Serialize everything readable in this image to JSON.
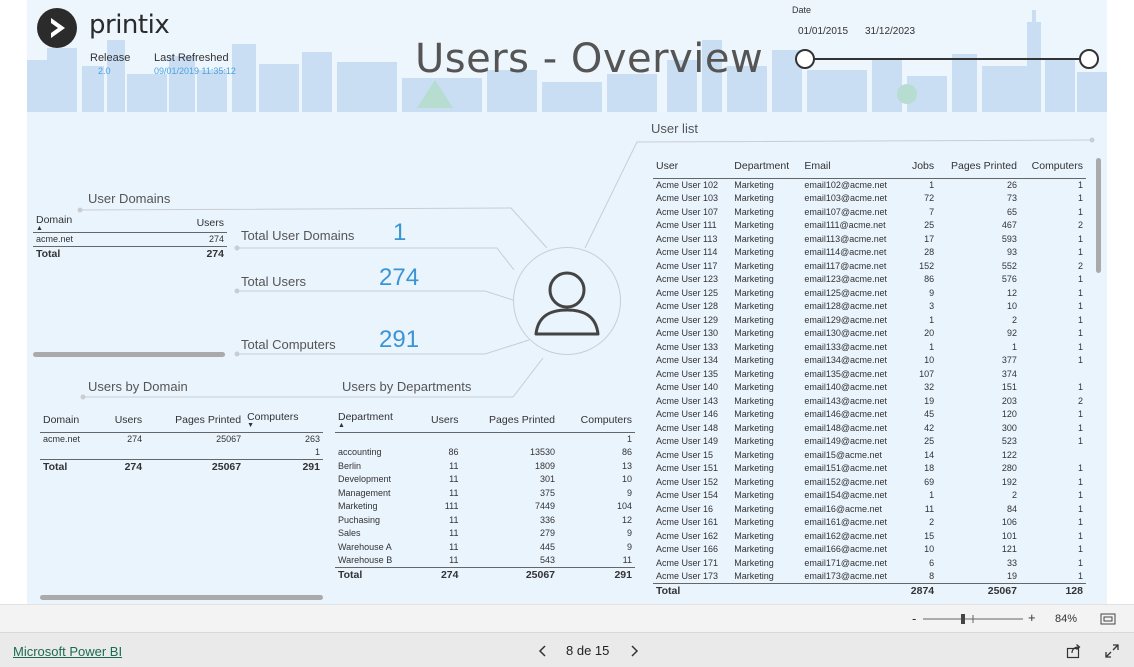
{
  "header": {
    "logo_text": "printix",
    "release_label": "Release",
    "release_value": "2.0",
    "refreshed_label": "Last Refreshed",
    "refreshed_value": "09/01/2019 11:35:12",
    "title": "Users - Overview",
    "date_label": "Date",
    "date_start": "01/01/2015",
    "date_end": "31/12/2023"
  },
  "user_domains": {
    "title": "User Domains",
    "headers": [
      "Domain",
      "Users"
    ],
    "rows": [
      [
        "acme.net",
        "274"
      ]
    ],
    "total": [
      "Total",
      "274"
    ]
  },
  "kpis": [
    {
      "label": "Total User Domains",
      "value": "1"
    },
    {
      "label": "Total Users",
      "value": "274"
    },
    {
      "label": "Total Computers",
      "value": "291"
    }
  ],
  "users_by_domain": {
    "title": "Users by Domain",
    "headers": [
      "Domain",
      "Users",
      "Pages Printed",
      "Computers"
    ],
    "rows": [
      [
        "acme.net",
        "274",
        "25067",
        "263"
      ],
      [
        "",
        "",
        "",
        "1"
      ]
    ],
    "total": [
      "Total",
      "274",
      "25067",
      "291"
    ]
  },
  "users_by_departments": {
    "title": "Users by Departments",
    "headers": [
      "Department",
      "Users",
      "Pages Printed",
      "Computers"
    ],
    "rows": [
      [
        "",
        "",
        "",
        "1"
      ],
      [
        "accounting",
        "86",
        "13530",
        "86"
      ],
      [
        "Berlin",
        "11",
        "1809",
        "13"
      ],
      [
        "Development",
        "11",
        "301",
        "10"
      ],
      [
        "Management",
        "11",
        "375",
        "9"
      ],
      [
        "Marketing",
        "111",
        "7449",
        "104"
      ],
      [
        "Puchasing",
        "11",
        "336",
        "12"
      ],
      [
        "Sales",
        "11",
        "279",
        "9"
      ],
      [
        "Warehouse A",
        "11",
        "445",
        "9"
      ],
      [
        "Warehouse B",
        "11",
        "543",
        "11"
      ]
    ],
    "total": [
      "Total",
      "274",
      "25067",
      "291"
    ]
  },
  "user_list": {
    "title": "User list",
    "headers": [
      "User",
      "Department",
      "Email",
      "Jobs",
      "Pages Printed",
      "Computers"
    ],
    "rows": [
      [
        "Acme User 102",
        "Marketing",
        "email102@acme.net",
        "1",
        "26",
        "1"
      ],
      [
        "Acme User 103",
        "Marketing",
        "email103@acme.net",
        "72",
        "73",
        "1"
      ],
      [
        "Acme User 107",
        "Marketing",
        "email107@acme.net",
        "7",
        "65",
        "1"
      ],
      [
        "Acme User 111",
        "Marketing",
        "email111@acme.net",
        "25",
        "467",
        "2"
      ],
      [
        "Acme User 113",
        "Marketing",
        "email113@acme.net",
        "17",
        "593",
        "1"
      ],
      [
        "Acme User 114",
        "Marketing",
        "email114@acme.net",
        "28",
        "93",
        "1"
      ],
      [
        "Acme User 117",
        "Marketing",
        "email117@acme.net",
        "152",
        "552",
        "2"
      ],
      [
        "Acme User 123",
        "Marketing",
        "email123@acme.net",
        "86",
        "576",
        "1"
      ],
      [
        "Acme User 125",
        "Marketing",
        "email125@acme.net",
        "9",
        "12",
        "1"
      ],
      [
        "Acme User 128",
        "Marketing",
        "email128@acme.net",
        "3",
        "10",
        "1"
      ],
      [
        "Acme User 129",
        "Marketing",
        "email129@acme.net",
        "1",
        "2",
        "1"
      ],
      [
        "Acme User 130",
        "Marketing",
        "email130@acme.net",
        "20",
        "92",
        "1"
      ],
      [
        "Acme User 133",
        "Marketing",
        "email133@acme.net",
        "1",
        "1",
        "1"
      ],
      [
        "Acme User 134",
        "Marketing",
        "email134@acme.net",
        "10",
        "377",
        "1"
      ],
      [
        "Acme User 135",
        "Marketing",
        "email135@acme.net",
        "107",
        "374",
        ""
      ],
      [
        "Acme User 140",
        "Marketing",
        "email140@acme.net",
        "32",
        "151",
        "1"
      ],
      [
        "Acme User 143",
        "Marketing",
        "email143@acme.net",
        "19",
        "203",
        "2"
      ],
      [
        "Acme User 146",
        "Marketing",
        "email146@acme.net",
        "45",
        "120",
        "1"
      ],
      [
        "Acme User 148",
        "Marketing",
        "email148@acme.net",
        "42",
        "300",
        "1"
      ],
      [
        "Acme User 149",
        "Marketing",
        "email149@acme.net",
        "25",
        "523",
        "1"
      ],
      [
        "Acme User 15",
        "Marketing",
        "email15@acme.net",
        "14",
        "122",
        ""
      ],
      [
        "Acme User 151",
        "Marketing",
        "email151@acme.net",
        "18",
        "280",
        "1"
      ],
      [
        "Acme User 152",
        "Marketing",
        "email152@acme.net",
        "69",
        "192",
        "1"
      ],
      [
        "Acme User 154",
        "Marketing",
        "email154@acme.net",
        "1",
        "2",
        "1"
      ],
      [
        "Acme User 16",
        "Marketing",
        "email16@acme.net",
        "11",
        "84",
        "1"
      ],
      [
        "Acme User 161",
        "Marketing",
        "email161@acme.net",
        "2",
        "106",
        "1"
      ],
      [
        "Acme User 162",
        "Marketing",
        "email162@acme.net",
        "15",
        "101",
        "1"
      ],
      [
        "Acme User 166",
        "Marketing",
        "email166@acme.net",
        "10",
        "121",
        "1"
      ],
      [
        "Acme User 171",
        "Marketing",
        "email171@acme.net",
        "6",
        "33",
        "1"
      ],
      [
        "Acme User 173",
        "Marketing",
        "email173@acme.net",
        "8",
        "19",
        "1"
      ]
    ],
    "total": [
      "Total",
      "",
      "",
      "2874",
      "25067",
      "128"
    ]
  },
  "bottom_bar": {
    "zoom_minus": "-",
    "zoom_plus": "+",
    "zoom_value": "84%"
  },
  "footer": {
    "brand_link": "Microsoft Power BI",
    "page_indicator": "8 de 15",
    "prev_icon": "chevron-left-icon",
    "next_icon": "chevron-right-icon"
  },
  "colors": {
    "canvas_bg": "#eaf4fd",
    "skyline": "#c9ddf3",
    "kpi_value": "#3a95d6",
    "meta_value": "#4aa3df",
    "link": "#1b6b52"
  }
}
